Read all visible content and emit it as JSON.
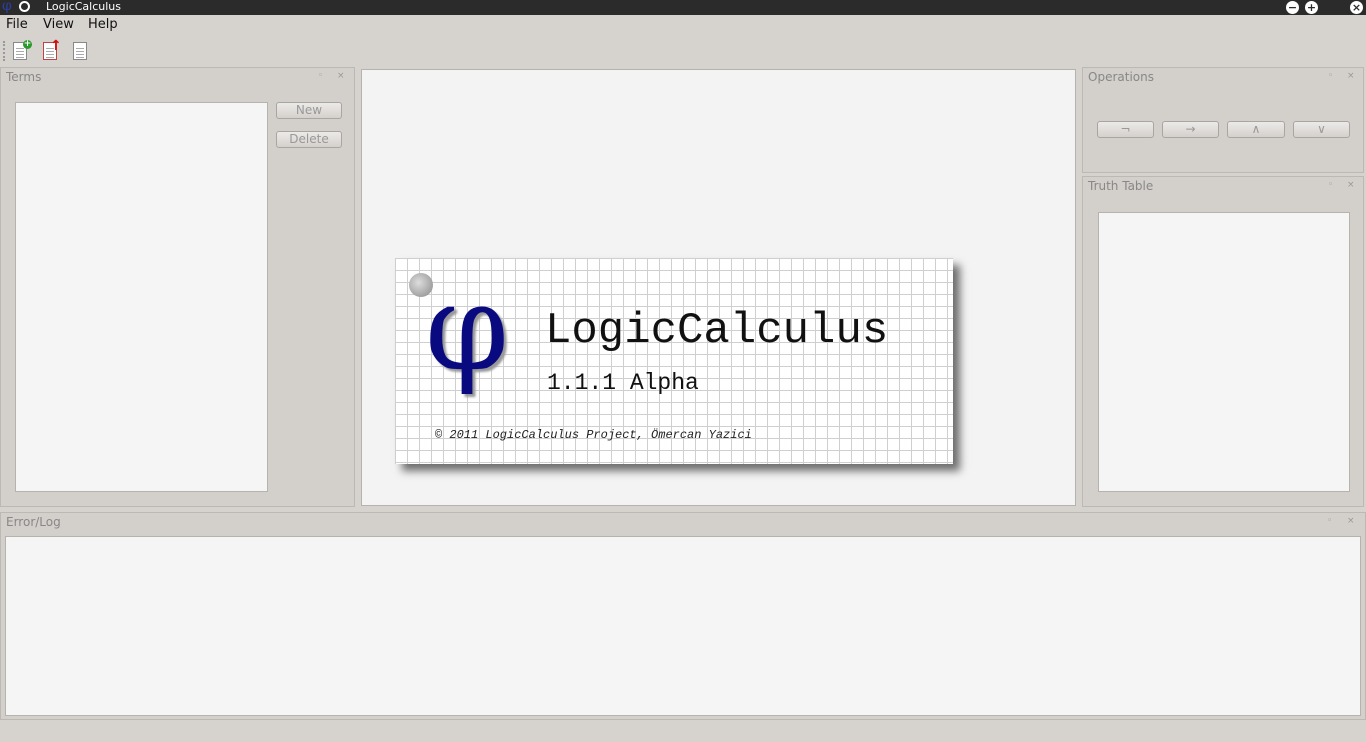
{
  "window": {
    "title": "LogicCalculus",
    "app_icon_glyph": "φ"
  },
  "menu": {
    "items": [
      "File",
      "View",
      "Help"
    ]
  },
  "toolbar": {
    "buttons": [
      "new-document-icon",
      "export-document-icon",
      "blank-document-icon"
    ]
  },
  "terms": {
    "title": "Terms",
    "new_label": "New",
    "delete_label": "Delete"
  },
  "operations": {
    "title": "Operations",
    "buttons": [
      "¬",
      "→",
      "∧",
      "∨"
    ]
  },
  "truth_table": {
    "title": "Truth Table"
  },
  "error_log": {
    "title": "Error/Log"
  },
  "splash": {
    "logo_glyph": "φ",
    "name": "LogicCalculus",
    "version": "1.1.1 Alpha",
    "copyright": "© 2011 LogicCalculus Project, Ömercan Yazici"
  },
  "dock_controls": {
    "float": "◦",
    "close": "×"
  },
  "colors": {
    "logo": "#0a0a80",
    "background": "#d6d2ce"
  }
}
